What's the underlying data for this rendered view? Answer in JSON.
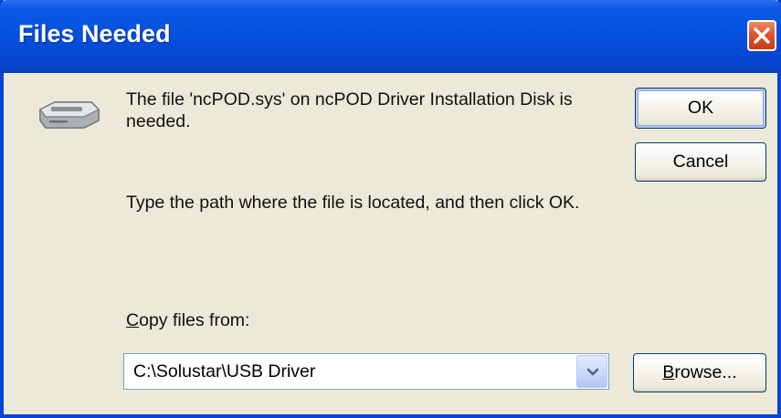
{
  "window": {
    "title": "Files Needed"
  },
  "message": {
    "line1": "The file 'ncPOD.sys' on ncPOD Driver Installation Disk is needed.",
    "line2": "Type the path where the file is located, and then click OK."
  },
  "copy_from": {
    "label_accel": "C",
    "label_rest": "opy files from:",
    "value": "C:\\Solustar\\USB Driver"
  },
  "buttons": {
    "ok": "OK",
    "cancel": "Cancel",
    "browse_accel": "B",
    "browse_rest": "rowse..."
  },
  "icons": {
    "drive": "disk-drive-icon",
    "close": "close-icon",
    "dropdown": "chevron-down-icon"
  },
  "colors": {
    "titlebar": "#0451de",
    "dialog_bg": "#ece9d8",
    "close_button": "#e0532d",
    "button_border": "#003c74"
  }
}
